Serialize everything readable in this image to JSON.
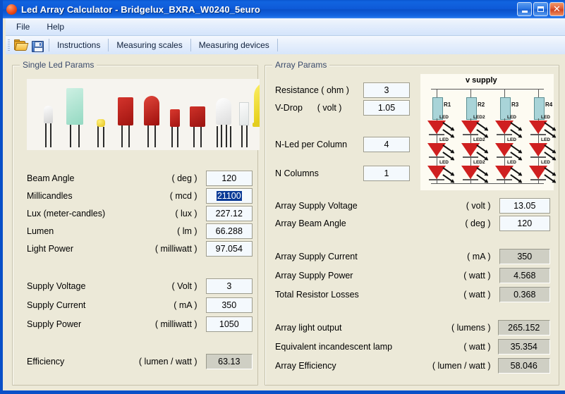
{
  "window": {
    "title": "Led Array Calculator - Bridgelux_BXRA_W0240_5euro",
    "icon": "app-led-icon",
    "buttons": {
      "minimize": "_",
      "maximize": "□",
      "close": "✕"
    }
  },
  "menu": {
    "items": [
      "File",
      "Help"
    ]
  },
  "toolbar": {
    "open_icon": "open-folder-icon",
    "save_icon": "save-floppy-icon",
    "buttons": [
      "Instructions",
      "Measuring scales",
      "Measuring devices"
    ]
  },
  "single_led": {
    "title": "Single Led Params",
    "photo_alt": "led-photo-strip",
    "rows": [
      {
        "label": "Beam Angle",
        "unit": "( deg )",
        "value": "120",
        "readonly": false,
        "selected": false
      },
      {
        "label": "Millicandles",
        "unit": "( mcd )",
        "value": "21100",
        "readonly": false,
        "selected": true
      },
      {
        "label": "Lux (meter-candles)",
        "unit": "( lux )",
        "value": "227.12",
        "readonly": false,
        "selected": false
      },
      {
        "label": "Lumen",
        "unit": "( lm )",
        "value": "66.288",
        "readonly": false,
        "selected": false
      },
      {
        "label": "Light Power",
        "unit": "( milliwatt )",
        "value": "97.054",
        "readonly": false,
        "selected": false
      },
      {
        "label": "Supply Voltage",
        "unit": "( Volt )",
        "value": "3",
        "readonly": false,
        "selected": false
      },
      {
        "label": "Supply Current",
        "unit": "( mA )",
        "value": "350",
        "readonly": false,
        "selected": false
      },
      {
        "label": "Supply Power",
        "unit": "( milliwatt )",
        "value": "1050",
        "readonly": false,
        "selected": false
      },
      {
        "label": "Efficiency",
        "unit": "( lumen / watt )",
        "value": "63.13",
        "readonly": true,
        "selected": false
      }
    ]
  },
  "array": {
    "title": "Array Params",
    "input_rows": [
      {
        "label": "Resistance ( ohm )",
        "value": "3"
      },
      {
        "label": "V-Drop      ( volt )",
        "value": "1.05"
      },
      {
        "label": "N-Led per Column",
        "value": "4"
      },
      {
        "label": "N Columns",
        "value": "1"
      }
    ],
    "result_rows": [
      {
        "label": "Array Supply Voltage",
        "unit": "( volt )",
        "value": "13.05",
        "readonly": false
      },
      {
        "label": "Array Beam Angle",
        "unit": "( deg )",
        "value": "120",
        "readonly": false
      },
      {
        "label": "Array Supply Current",
        "unit": "( mA )",
        "value": "350",
        "readonly": true
      },
      {
        "label": "Array Supply Power",
        "unit": "( watt )",
        "value": "4.568",
        "readonly": true
      },
      {
        "label": "Total Resistor Losses",
        "unit": "( watt )",
        "value": "0.368",
        "readonly": true
      },
      {
        "label": "Array light output",
        "unit": "( lumens )",
        "value": "265.152",
        "readonly": true
      },
      {
        "label": "Equivalent incandescent lamp",
        "unit": "( watt )",
        "value": "35.354",
        "readonly": true
      },
      {
        "label": "Array Efficiency",
        "unit": "( lumen / watt )",
        "value": "58.046",
        "readonly": true
      }
    ],
    "circuit": {
      "supply_label": "v supply",
      "resistors": [
        "R1",
        "R2",
        "R3",
        "R4"
      ],
      "led_labels": [
        [
          "LED",
          "LED2",
          "LED",
          "LED"
        ],
        [
          "LED",
          "LED2",
          "LED",
          "LED"
        ],
        [
          "LED",
          "LED2",
          "LED",
          "LED"
        ]
      ]
    }
  },
  "colors": {
    "title_bar": "#0a50c8",
    "window_face": "#ece9d8",
    "group_label": "#3a4a6b",
    "field_bg": "#f4f9fd",
    "readonly_bg": "#cfcfc4",
    "selection": "#0a3a96",
    "led_red": "#cf2020",
    "resistor": "#a9d4d8"
  }
}
